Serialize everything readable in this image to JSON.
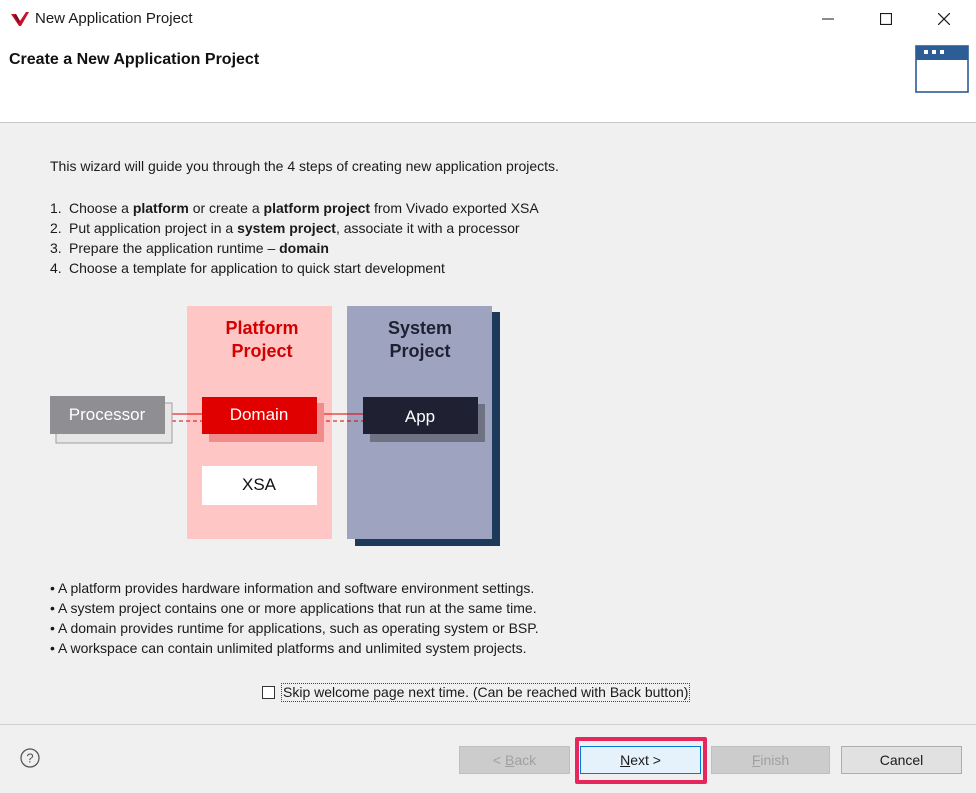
{
  "window": {
    "title": "New Application Project"
  },
  "banner": {
    "title": "Create a New Application Project"
  },
  "intro": "This wizard will guide you through the 4 steps of creating new application projects.",
  "steps": [
    {
      "num": "1.",
      "parts": [
        {
          "t": "Choose a "
        },
        {
          "t": "platform",
          "b": true
        },
        {
          "t": " or create a "
        },
        {
          "t": "platform project",
          "b": true
        },
        {
          "t": " from Vivado exported XSA"
        }
      ]
    },
    {
      "num": "2.",
      "parts": [
        {
          "t": "Put application project in a "
        },
        {
          "t": "system project",
          "b": true
        },
        {
          "t": ", associate it with a processor"
        }
      ]
    },
    {
      "num": "3.",
      "parts": [
        {
          "t": "Prepare the application runtime – "
        },
        {
          "t": "domain",
          "b": true
        }
      ]
    },
    {
      "num": "4.",
      "parts": [
        {
          "t": "Choose a template for application to quick start development"
        }
      ]
    }
  ],
  "diagram": {
    "platform_title": [
      "Platform",
      "Project"
    ],
    "system_title": [
      "System",
      "Project"
    ],
    "processor": "Processor",
    "domain": "Domain",
    "xsa": "XSA",
    "app": "App",
    "colors": {
      "platform_bg": "#ffc6c6",
      "system_bg": "#9ea3c0",
      "domain": "#e00000",
      "app": "#1f2133",
      "processor": "#8e8e93",
      "red_text": "#d40000"
    }
  },
  "notes": [
    "• A platform provides hardware information and software environment settings.",
    "• A system project contains one or more applications that run at the same time.",
    "• A domain provides runtime for applications, such as operating system or BSP.",
    "• A workspace can contain unlimited platforms and unlimited system projects."
  ],
  "skip_label": "Skip welcome page next time. (Can be reached with Back button)",
  "buttons": {
    "back": {
      "pre": "< ",
      "ul": "B",
      "post": "ack"
    },
    "next": {
      "pre": "",
      "ul": "N",
      "post": "ext >"
    },
    "finish": {
      "pre": "",
      "ul": "F",
      "post": "inish"
    },
    "cancel": "Cancel"
  },
  "highlight_color": "#e8265e"
}
